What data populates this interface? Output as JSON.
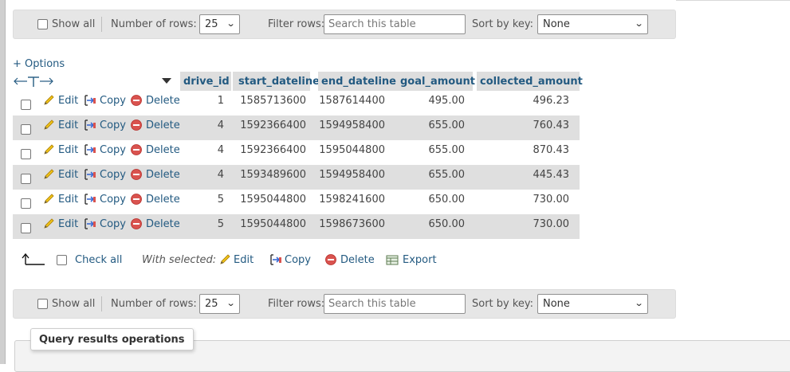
{
  "nav": {
    "show_all_label": "Show all",
    "rows_label": "Number of rows:",
    "rows_value": "25",
    "filter_label": "Filter rows:",
    "filter_placeholder": "Search this table",
    "sort_label": "Sort by key:",
    "sort_value": "None"
  },
  "options_label": "+ Options",
  "table": {
    "columns": [
      "drive_id",
      "start_dateline",
      "end_dateline",
      "goal_amount",
      "collected_amount"
    ],
    "actions": {
      "edit": "Edit",
      "copy": "Copy",
      "delete": "Delete"
    },
    "rows": [
      [
        "1",
        "1585713600",
        "1587614400",
        "495.00",
        "496.23"
      ],
      [
        "4",
        "1592366400",
        "1594958400",
        "655.00",
        "760.43"
      ],
      [
        "4",
        "1592366400",
        "1595044800",
        "655.00",
        "870.43"
      ],
      [
        "4",
        "1593489600",
        "1594958400",
        "655.00",
        "445.43"
      ],
      [
        "5",
        "1595044800",
        "1598241600",
        "650.00",
        "730.00"
      ],
      [
        "5",
        "1595044800",
        "1598673600",
        "650.00",
        "730.00"
      ]
    ]
  },
  "bulk": {
    "check_all": "Check all",
    "with_selected": "With selected:",
    "edit": "Edit",
    "copy": "Copy",
    "delete": "Delete",
    "export": "Export"
  },
  "query_results": {
    "legend": "Query results operations"
  },
  "colors": {
    "link": "#235a81",
    "row_alt": "#dfdfdf",
    "header_bg": "#dedede",
    "delete_red": "#d9534f"
  }
}
